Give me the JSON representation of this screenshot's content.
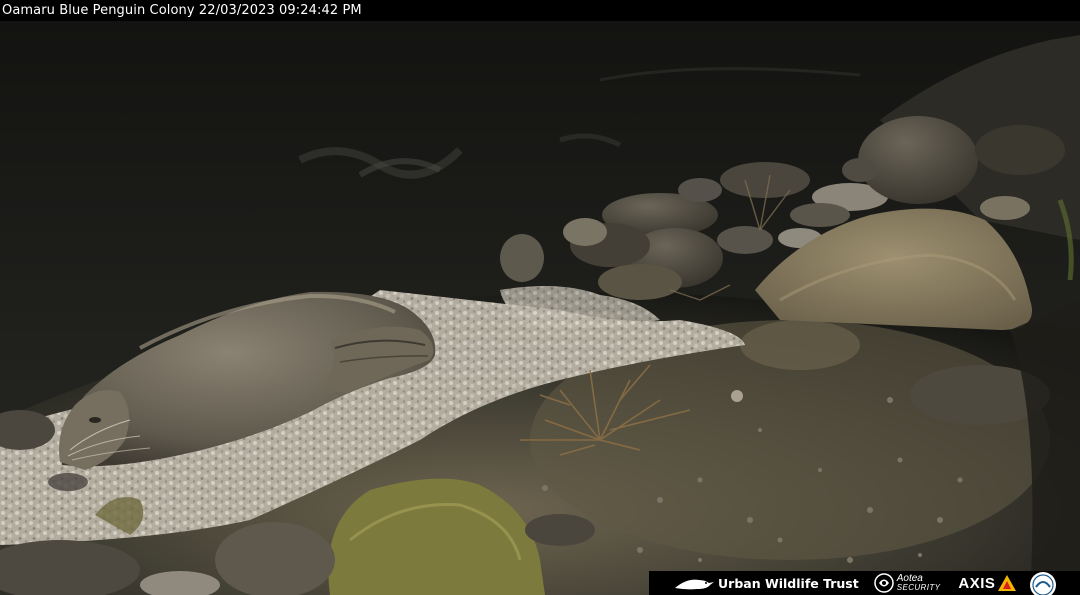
{
  "overlay": {
    "camera_label": "Oamaru Blue Penguin Colony 22/03/2023 09:24:42 PM"
  },
  "sponsors": {
    "urban_wildlife_trust": "Urban Wildlife Trust",
    "aotea_line1": "Aotea",
    "aotea_line2": "SECURITY",
    "axis": "AXIS"
  },
  "colors": {
    "osd_text": "#ffffff",
    "bar_background": "#000000",
    "axis_triangle": "#f6b400"
  }
}
